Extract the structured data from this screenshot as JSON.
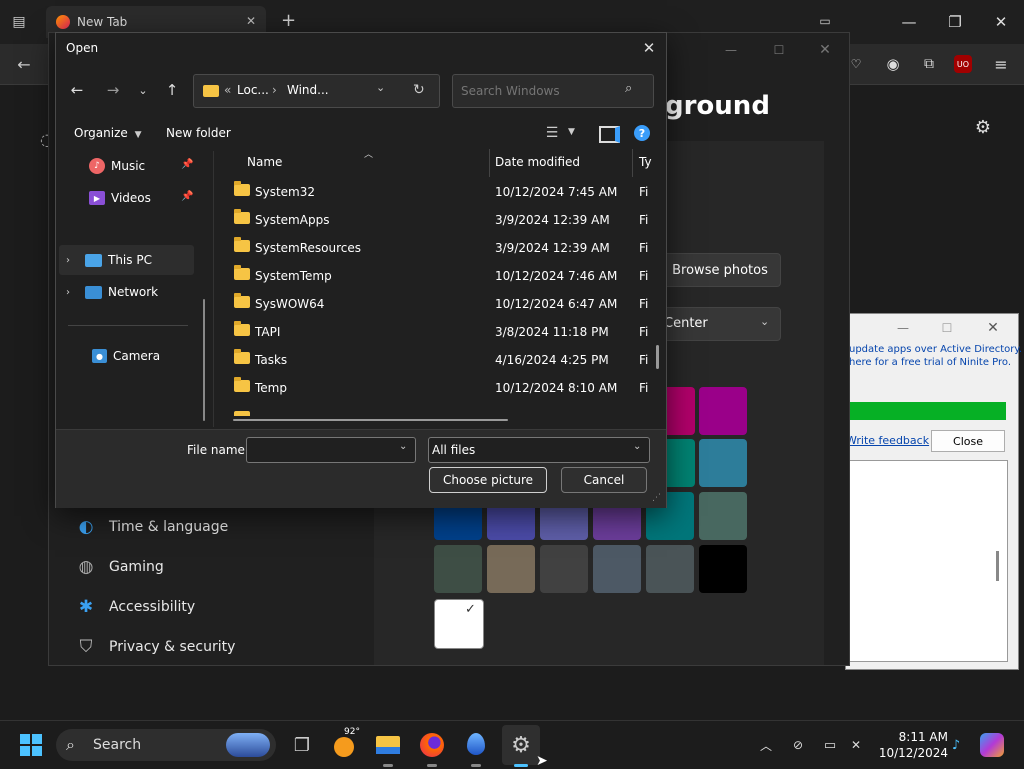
{
  "browser": {
    "tab_title": "New Tab",
    "new_tab_glyph": "+",
    "close_glyph": "✕"
  },
  "settings": {
    "heading_partial": "ground",
    "browse_photos": "Browse photos",
    "fit_dropdown": "Center",
    "nav": {
      "time_language": "Time & language",
      "gaming": "Gaming",
      "accessibility": "Accessibility",
      "privacy_security": "Privacy & security"
    },
    "swatches": [
      "#b1006a",
      "#9a0089",
      "#008272",
      "#2d7d9a",
      "#00408a",
      "#4b4ba8",
      "#5e5ea8",
      "#6b3d9a",
      "#00767a",
      "#486860",
      "#3e4e45",
      "#776a58",
      "#414141",
      "#4d5965",
      "#4a5457",
      "#000000",
      "#ffffff"
    ]
  },
  "ninite": {
    "line1": "update apps over Active Directory.",
    "line2": "here for a free trial of Ninite Pro.",
    "feedback": "Write feedback",
    "close": "Close",
    "progress_color": "#06b025"
  },
  "dialog": {
    "title": "Open",
    "breadcrumb_prefix": "«",
    "breadcrumb_1": "Loc...",
    "breadcrumb_sep": "›",
    "breadcrumb_2": "Wind...",
    "search_placeholder": "Search Windows",
    "organize": "Organize",
    "new_folder": "New folder",
    "tree": [
      {
        "label": "Music"
      },
      {
        "label": "Videos"
      },
      {
        "label": "This PC"
      },
      {
        "label": "Network"
      },
      {
        "label": "Camera"
      }
    ],
    "columns": {
      "name": "Name",
      "date": "Date modified",
      "type": "Ty"
    },
    "files": [
      {
        "name": "System32",
        "date": "10/12/2024 7:45 AM",
        "type": "Fi"
      },
      {
        "name": "SystemApps",
        "date": "3/9/2024 12:39 AM",
        "type": "Fi"
      },
      {
        "name": "SystemResources",
        "date": "3/9/2024 12:39 AM",
        "type": "Fi"
      },
      {
        "name": "SystemTemp",
        "date": "10/12/2024 7:46 AM",
        "type": "Fi"
      },
      {
        "name": "SysWOW64",
        "date": "10/12/2024 6:47 AM",
        "type": "Fi"
      },
      {
        "name": "TAPI",
        "date": "3/8/2024 11:18 PM",
        "type": "Fi"
      },
      {
        "name": "Tasks",
        "date": "4/16/2024 4:25 PM",
        "type": "Fi"
      },
      {
        "name": "Temp",
        "date": "10/12/2024 8:10 AM",
        "type": "Fi"
      }
    ],
    "file_name_label": "File name:",
    "file_name_value": "",
    "filter": "All files",
    "choose": "Choose picture",
    "cancel": "Cancel",
    "help_glyph": "?"
  },
  "taskbar": {
    "search": "Search",
    "weather": "92°",
    "time": "8:11 AM",
    "date": "10/12/2024"
  }
}
